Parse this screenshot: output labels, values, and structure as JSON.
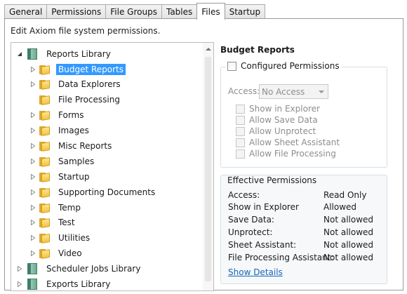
{
  "tabs": [
    {
      "label": "General"
    },
    {
      "label": "Permissions"
    },
    {
      "label": "File Groups"
    },
    {
      "label": "Tables"
    },
    {
      "label": "Files",
      "active": true
    },
    {
      "label": "Startup"
    }
  ],
  "description": "Edit Axiom file system permissions.",
  "tree": {
    "root": {
      "label": "Reports Library",
      "expanded": true
    },
    "folders": [
      {
        "label": "Budget Reports",
        "selected": true
      },
      {
        "label": "Data Explorers"
      },
      {
        "label": "File Processing"
      },
      {
        "label": "Forms"
      },
      {
        "label": "Images"
      },
      {
        "label": "Misc Reports"
      },
      {
        "label": "Samples"
      },
      {
        "label": "Startup"
      },
      {
        "label": "Supporting Documents"
      },
      {
        "label": "Temp"
      },
      {
        "label": "Test"
      },
      {
        "label": "Utilities"
      },
      {
        "label": "Video"
      }
    ],
    "libraries": [
      {
        "label": "Scheduler Jobs Library"
      },
      {
        "label": "Exports Library"
      }
    ]
  },
  "selected_folder": {
    "title": "Budget Reports",
    "configured_label": "Configured Permissions",
    "access_label": "Access:",
    "access_value": "No Access",
    "permissions": [
      {
        "label": "Show in Explorer"
      },
      {
        "label": "Allow Save Data"
      },
      {
        "label": "Allow Unprotect"
      },
      {
        "label": "Allow Sheet Assistant"
      },
      {
        "label": "Allow File Processing"
      }
    ]
  },
  "effective": {
    "legend": "Effective Permissions",
    "rows": [
      {
        "label": "Access:",
        "value": "Read Only"
      },
      {
        "label": "Show in Explorer",
        "value": "Allowed"
      },
      {
        "label": "Save Data:",
        "value": "Not allowed"
      },
      {
        "label": "Unprotect:",
        "value": "Not allowed"
      },
      {
        "label": "Sheet Assistant:",
        "value": "Not allowed"
      },
      {
        "label": "File Processing Assistant:",
        "value": "Not allowed"
      }
    ],
    "show_details": "Show Details"
  },
  "colors": {
    "selection": "#3399ff",
    "link": "#1565c0",
    "folder": "#f3c443",
    "library": "#6aa98e"
  }
}
